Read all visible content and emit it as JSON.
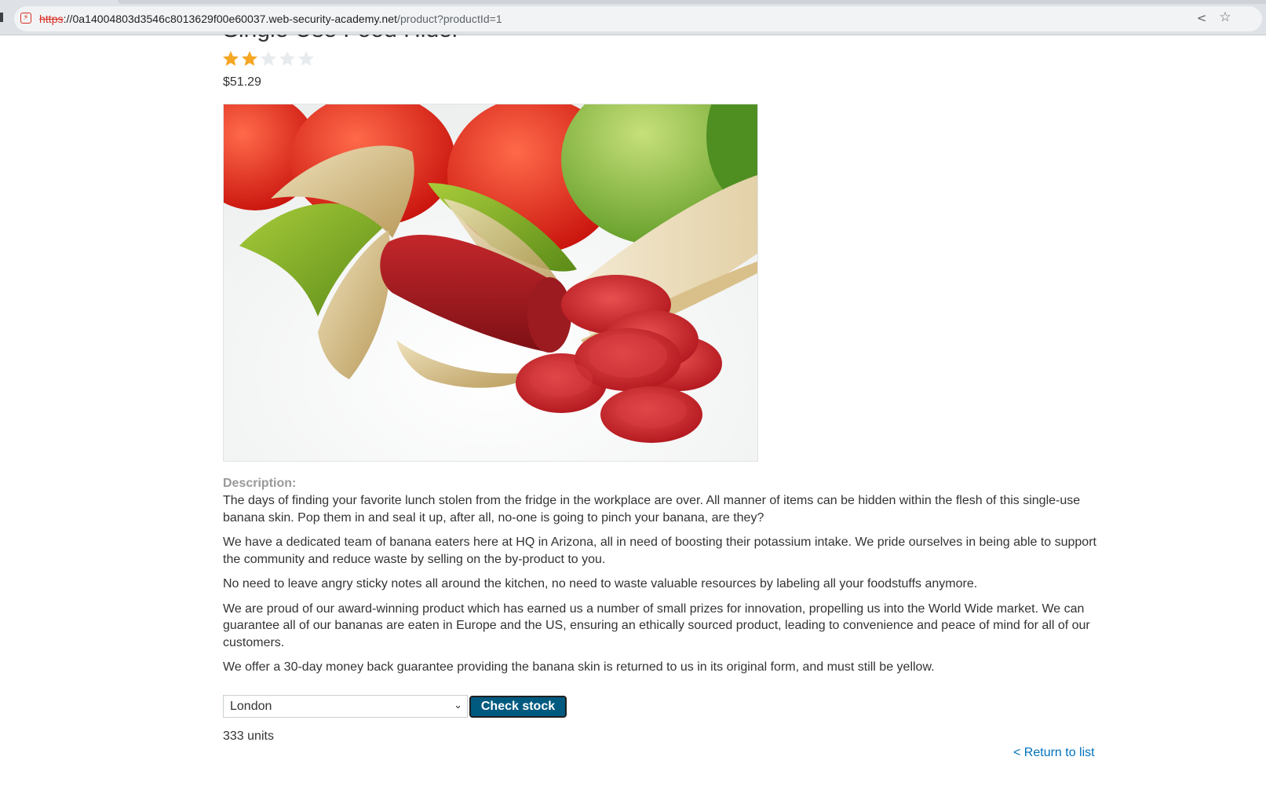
{
  "browser": {
    "url_scheme": "https",
    "url_sep": "://",
    "url_host": "0a14004803d3546c8013629f00e60037.web-security-academy.net",
    "url_path": "/product?productId=1",
    "site_icon": "not-secure-icon",
    "share_icon": "share-icon",
    "bookmark_icon": "bookmark-star-icon"
  },
  "product": {
    "title": "Single Use Food Hider",
    "rating": 2,
    "rating_max": 5,
    "price": "$51.29",
    "image_alt": "banana-skin-with-sausage"
  },
  "description": {
    "label": "Description:",
    "paragraphs": [
      "The days of finding your favorite lunch stolen from the fridge in the workplace are over. All manner of items can be hidden within the flesh of this single-use banana skin. Pop them in and seal it up, after all, no-one is going to pinch your banana, are they?",
      "We have a dedicated team of banana eaters here at HQ in Arizona, all in need of boosting their potassium intake. We pride ourselves in being able to support the community and reduce waste by selling on the by-product to you.",
      "No need to leave angry sticky notes all around the kitchen, no need to waste valuable resources by labeling all your foodstuffs anymore.",
      "We are proud of our award-winning product which has earned us a number of small prizes for innovation, propelling us into the World Wide market. We can guarantee all of our bananas are eaten in Europe and the US, ensuring an ethically sourced product, leading to convenience and peace of mind for all of our customers.",
      "We offer a 30-day money back guarantee providing the banana skin is returned to us in its original form, and must still be yellow."
    ]
  },
  "stock": {
    "selected_location": "London",
    "check_button": "Check stock",
    "result": "333 units"
  },
  "nav": {
    "return_link": "< Return to list"
  },
  "colors": {
    "star_filled": "#f5a623",
    "star_empty": "#e8ebed",
    "button": "#005a80",
    "link": "#0071bc"
  }
}
